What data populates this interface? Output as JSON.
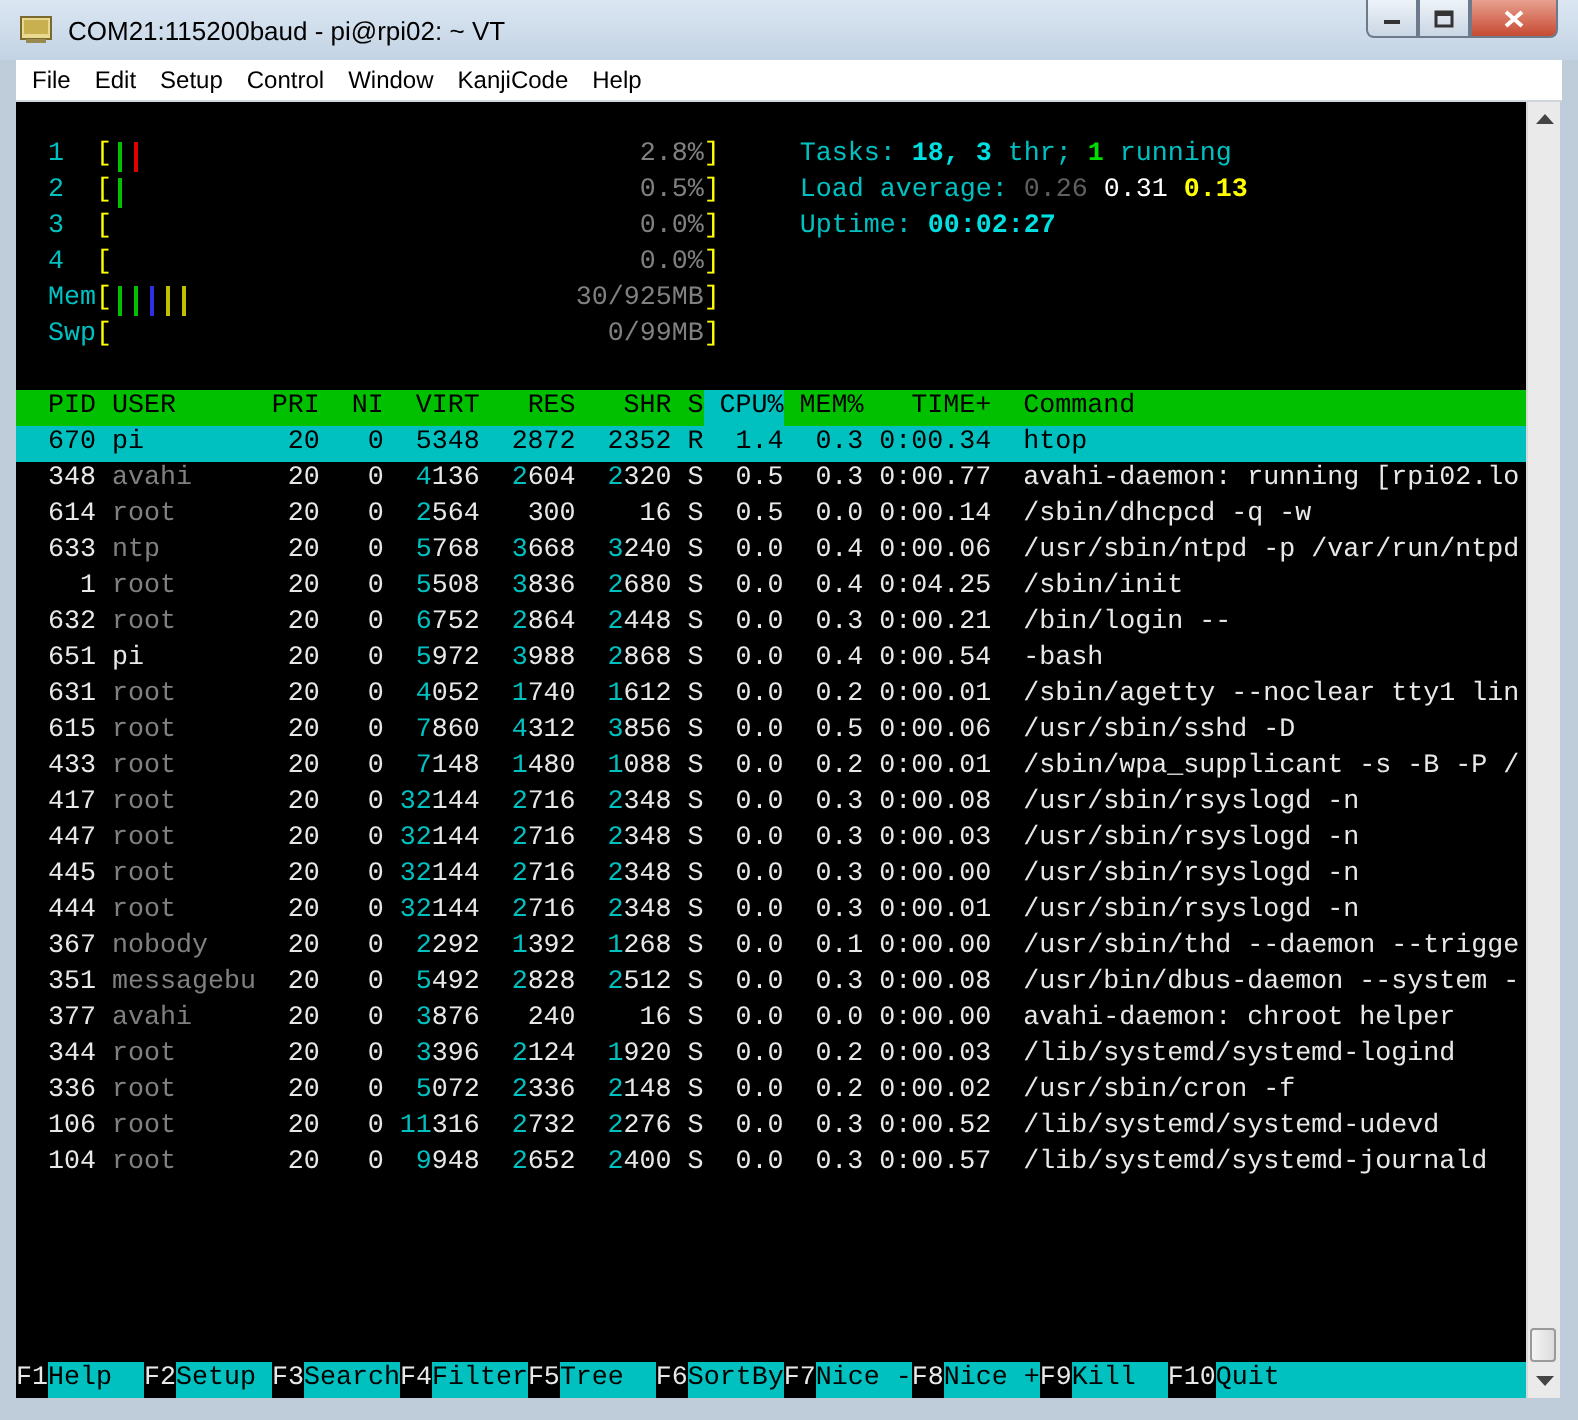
{
  "window": {
    "title": "COM21:115200baud - pi@rpi02: ~ VT"
  },
  "menu": [
    "File",
    "Edit",
    "Setup",
    "Control",
    "Window",
    "KanjiCode",
    "Help"
  ],
  "meters": [
    {
      "label": "1",
      "open": "[",
      "bars": [
        {
          "color": "#00c000"
        },
        {
          "color": "#e00000"
        }
      ],
      "value": "2.8%",
      "close": "]"
    },
    {
      "label": "2",
      "open": "[",
      "bars": [
        {
          "color": "#00c000"
        }
      ],
      "value": "0.5%",
      "close": "]"
    },
    {
      "label": "3",
      "open": "[",
      "value": "0.0%",
      "close": "]"
    },
    {
      "label": "4",
      "open": "[",
      "value": "0.0%",
      "close": "]"
    },
    {
      "label": "Mem",
      "open": "[",
      "bars": [
        {
          "color": "#00c000"
        },
        {
          "color": "#00c000"
        },
        {
          "color": "#3030e0"
        },
        {
          "color": "#c0c000"
        },
        {
          "color": "#c0c000"
        }
      ],
      "value": "30/925MB",
      "close": "]"
    },
    {
      "label": "Swp",
      "open": "[",
      "value": "0/99MB",
      "close": "]"
    }
  ],
  "summary": [
    [
      {
        "text": "Tasks: ",
        "color": "#00c0c0",
        "bold": false
      },
      {
        "text": "18, 3",
        "color": "#00e0e0",
        "bold": true
      },
      {
        "text": " thr; ",
        "color": "#00c0c0",
        "bold": false
      },
      {
        "text": "1",
        "color": "#00e000",
        "bold": true
      },
      {
        "text": " running",
        "color": "#00c0c0",
        "bold": false
      }
    ],
    [
      {
        "text": "Load average: ",
        "color": "#00c0c0",
        "bold": false
      },
      {
        "text": "0.26 ",
        "color": "#606060",
        "bold": false
      },
      {
        "text": "0.31 ",
        "color": "#ffffff",
        "bold": false
      },
      {
        "text": "0.13",
        "color": "#ffff00",
        "bold": true
      }
    ],
    [
      {
        "text": "Uptime: ",
        "color": "#00c0c0",
        "bold": false
      },
      {
        "text": "00:02:27",
        "color": "#00e0e0",
        "bold": true
      }
    ]
  ],
  "columns": [
    {
      "label": "PID",
      "selected": false
    },
    {
      "label": "USER",
      "selected": false
    },
    {
      "label": "PRI",
      "selected": false
    },
    {
      "label": "NI",
      "selected": false
    },
    {
      "label": "VIRT",
      "selected": false
    },
    {
      "label": "RES",
      "selected": false
    },
    {
      "label": "SHR",
      "selected": false
    },
    {
      "label": "S",
      "selected": false
    },
    {
      "label": "CPU%",
      "selected": true
    },
    {
      "label": "MEM%",
      "selected": false
    },
    {
      "label": "TIME+",
      "selected": false
    },
    {
      "label": "Command",
      "selected": false
    }
  ],
  "processes": [
    {
      "pid": "670",
      "user": "pi",
      "own_user": true,
      "pri": "20",
      "ni": "0",
      "virt": "5348",
      "res": "2872",
      "shr": "2352",
      "state": "R",
      "cpu": "1.4",
      "mem": "0.3",
      "time": "0:00.34",
      "command": "htop",
      "selected": true
    },
    {
      "pid": "348",
      "user": "avahi",
      "own_user": false,
      "pri": "20",
      "ni": "0",
      "virt": "4136",
      "res": "2604",
      "shr": "2320",
      "state": "S",
      "cpu": "0.5",
      "mem": "0.3",
      "time": "0:00.77",
      "command": "avahi-daemon: running [rpi02.lo",
      "selected": false
    },
    {
      "pid": "614",
      "user": "root",
      "own_user": false,
      "pri": "20",
      "ni": "0",
      "virt": "2564",
      "res": "300",
      "shr": "16",
      "state": "S",
      "cpu": "0.5",
      "mem": "0.0",
      "time": "0:00.14",
      "command": "/sbin/dhcpcd -q -w",
      "selected": false
    },
    {
      "pid": "633",
      "user": "ntp",
      "own_user": false,
      "pri": "20",
      "ni": "0",
      "virt": "5768",
      "res": "3668",
      "shr": "3240",
      "state": "S",
      "cpu": "0.0",
      "mem": "0.4",
      "time": "0:00.06",
      "command": "/usr/sbin/ntpd -p /var/run/ntpd",
      "selected": false
    },
    {
      "pid": "1",
      "user": "root",
      "own_user": false,
      "pri": "20",
      "ni": "0",
      "virt": "5508",
      "res": "3836",
      "shr": "2680",
      "state": "S",
      "cpu": "0.0",
      "mem": "0.4",
      "time": "0:04.25",
      "command": "/sbin/init",
      "selected": false
    },
    {
      "pid": "632",
      "user": "root",
      "own_user": false,
      "pri": "20",
      "ni": "0",
      "virt": "6752",
      "res": "2864",
      "shr": "2448",
      "state": "S",
      "cpu": "0.0",
      "mem": "0.3",
      "time": "0:00.21",
      "command": "/bin/login --",
      "selected": false
    },
    {
      "pid": "651",
      "user": "pi",
      "own_user": true,
      "pri": "20",
      "ni": "0",
      "virt": "5972",
      "res": "3988",
      "shr": "2868",
      "state": "S",
      "cpu": "0.0",
      "mem": "0.4",
      "time": "0:00.54",
      "command": "-bash",
      "selected": false
    },
    {
      "pid": "631",
      "user": "root",
      "own_user": false,
      "pri": "20",
      "ni": "0",
      "virt": "4052",
      "res": "1740",
      "shr": "1612",
      "state": "S",
      "cpu": "0.0",
      "mem": "0.2",
      "time": "0:00.01",
      "command": "/sbin/agetty --noclear tty1 lin",
      "selected": false
    },
    {
      "pid": "615",
      "user": "root",
      "own_user": false,
      "pri": "20",
      "ni": "0",
      "virt": "7860",
      "res": "4312",
      "shr": "3856",
      "state": "S",
      "cpu": "0.0",
      "mem": "0.5",
      "time": "0:00.06",
      "command": "/usr/sbin/sshd -D",
      "selected": false
    },
    {
      "pid": "433",
      "user": "root",
      "own_user": false,
      "pri": "20",
      "ni": "0",
      "virt": "7148",
      "res": "1480",
      "shr": "1088",
      "state": "S",
      "cpu": "0.0",
      "mem": "0.2",
      "time": "0:00.01",
      "command": "/sbin/wpa_supplicant -s -B -P /",
      "selected": false
    },
    {
      "pid": "417",
      "user": "root",
      "own_user": false,
      "pri": "20",
      "ni": "0",
      "virt": "32144",
      "res": "2716",
      "shr": "2348",
      "state": "S",
      "cpu": "0.0",
      "mem": "0.3",
      "time": "0:00.08",
      "command": "/usr/sbin/rsyslogd -n",
      "selected": false
    },
    {
      "pid": "447",
      "user": "root",
      "own_user": false,
      "pri": "20",
      "ni": "0",
      "virt": "32144",
      "res": "2716",
      "shr": "2348",
      "state": "S",
      "cpu": "0.0",
      "mem": "0.3",
      "time": "0:00.03",
      "command": "/usr/sbin/rsyslogd -n",
      "selected": false
    },
    {
      "pid": "445",
      "user": "root",
      "own_user": false,
      "pri": "20",
      "ni": "0",
      "virt": "32144",
      "res": "2716",
      "shr": "2348",
      "state": "S",
      "cpu": "0.0",
      "mem": "0.3",
      "time": "0:00.00",
      "command": "/usr/sbin/rsyslogd -n",
      "selected": false
    },
    {
      "pid": "444",
      "user": "root",
      "own_user": false,
      "pri": "20",
      "ni": "0",
      "virt": "32144",
      "res": "2716",
      "shr": "2348",
      "state": "S",
      "cpu": "0.0",
      "mem": "0.3",
      "time": "0:00.01",
      "command": "/usr/sbin/rsyslogd -n",
      "selected": false
    },
    {
      "pid": "367",
      "user": "nobody",
      "own_user": false,
      "pri": "20",
      "ni": "0",
      "virt": "2292",
      "res": "1392",
      "shr": "1268",
      "state": "S",
      "cpu": "0.0",
      "mem": "0.1",
      "time": "0:00.00",
      "command": "/usr/sbin/thd --daemon --trigge",
      "selected": false
    },
    {
      "pid": "351",
      "user": "messagebu",
      "own_user": false,
      "pri": "20",
      "ni": "0",
      "virt": "5492",
      "res": "2828",
      "shr": "2512",
      "state": "S",
      "cpu": "0.0",
      "mem": "0.3",
      "time": "0:00.08",
      "command": "/usr/bin/dbus-daemon --system -",
      "selected": false
    },
    {
      "pid": "377",
      "user": "avahi",
      "own_user": false,
      "pri": "20",
      "ni": "0",
      "virt": "3876",
      "res": "240",
      "shr": "16",
      "state": "S",
      "cpu": "0.0",
      "mem": "0.0",
      "time": "0:00.00",
      "command": "avahi-daemon: chroot helper",
      "selected": false
    },
    {
      "pid": "344",
      "user": "root",
      "own_user": false,
      "pri": "20",
      "ni": "0",
      "virt": "3396",
      "res": "2124",
      "shr": "1920",
      "state": "S",
      "cpu": "0.0",
      "mem": "0.2",
      "time": "0:00.03",
      "command": "/lib/systemd/systemd-logind",
      "selected": false
    },
    {
      "pid": "336",
      "user": "root",
      "own_user": false,
      "pri": "20",
      "ni": "0",
      "virt": "5072",
      "res": "2336",
      "shr": "2148",
      "state": "S",
      "cpu": "0.0",
      "mem": "0.2",
      "time": "0:00.02",
      "command": "/usr/sbin/cron -f",
      "selected": false
    },
    {
      "pid": "106",
      "user": "root",
      "own_user": false,
      "pri": "20",
      "ni": "0",
      "virt": "11316",
      "res": "2732",
      "shr": "2276",
      "state": "S",
      "cpu": "0.0",
      "mem": "0.3",
      "time": "0:00.52",
      "command": "/lib/systemd/systemd-udevd",
      "selected": false
    },
    {
      "pid": "104",
      "user": "root",
      "own_user": false,
      "pri": "20",
      "ni": "0",
      "virt": "9948",
      "res": "2652",
      "shr": "2400",
      "state": "S",
      "cpu": "0.0",
      "mem": "0.3",
      "time": "0:00.57",
      "command": "/lib/systemd/systemd-journald",
      "selected": false
    }
  ],
  "function_keys": [
    {
      "key": "F1",
      "label": "Help"
    },
    {
      "key": "F2",
      "label": "Setup"
    },
    {
      "key": "F3",
      "label": "Search"
    },
    {
      "key": "F4",
      "label": "Filter"
    },
    {
      "key": "F5",
      "label": "Tree"
    },
    {
      "key": "F6",
      "label": "SortBy"
    },
    {
      "key": "F7",
      "label": "Nice -"
    },
    {
      "key": "F8",
      "label": "Nice +"
    },
    {
      "key": "F9",
      "label": "Kill"
    },
    {
      "key": "F10",
      "label": "Quit"
    }
  ]
}
